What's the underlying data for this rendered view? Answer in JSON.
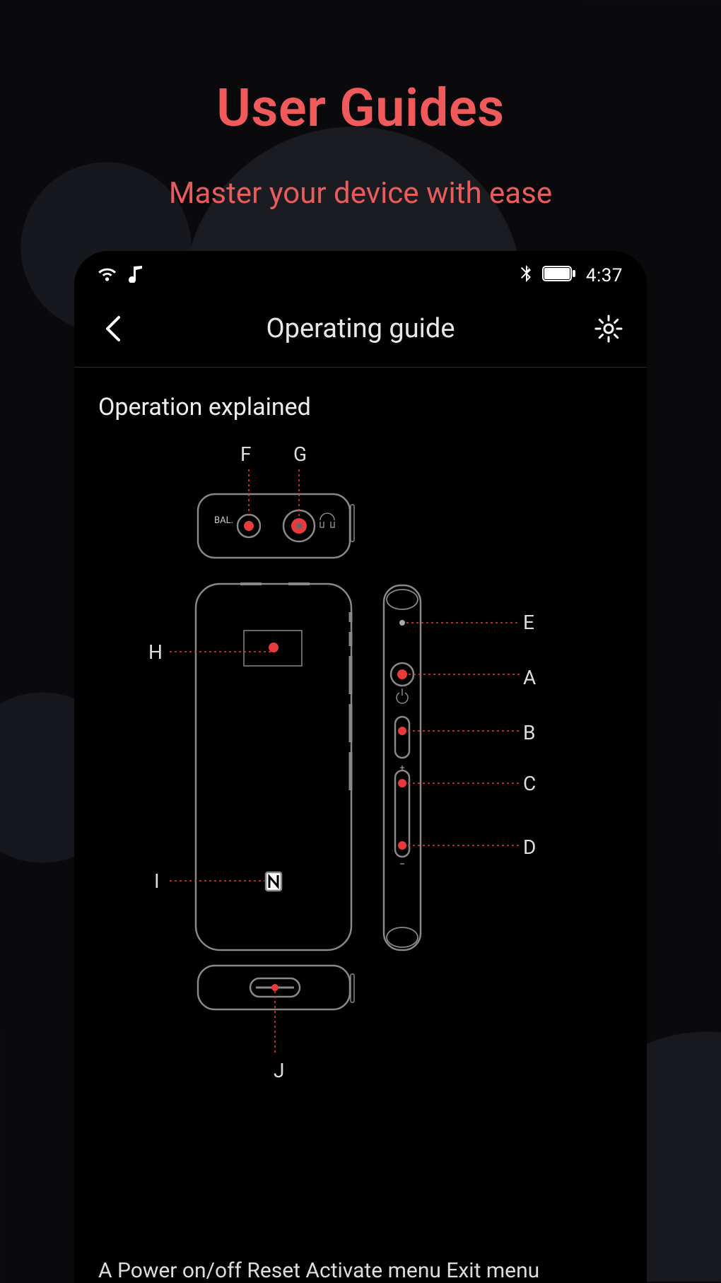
{
  "promo": {
    "title": "User Guides",
    "subtitle": "Master your device with ease"
  },
  "statusbar": {
    "time": "4:37"
  },
  "header": {
    "title": "Operating guide"
  },
  "section": {
    "heading": "Operation explained"
  },
  "labels": {
    "A": "A",
    "B": "B",
    "C": "C",
    "D": "D",
    "E": "E",
    "F": "F",
    "G": "G",
    "H": "H",
    "I": "I",
    "J": "J"
  },
  "top_port": {
    "bal_label": "BAL."
  },
  "footer": {
    "text": "A Power on/off  Reset  Activate menu  Exit menu"
  },
  "colors": {
    "accent": "#f05a5a",
    "diagram_red": "#e83a3a"
  }
}
